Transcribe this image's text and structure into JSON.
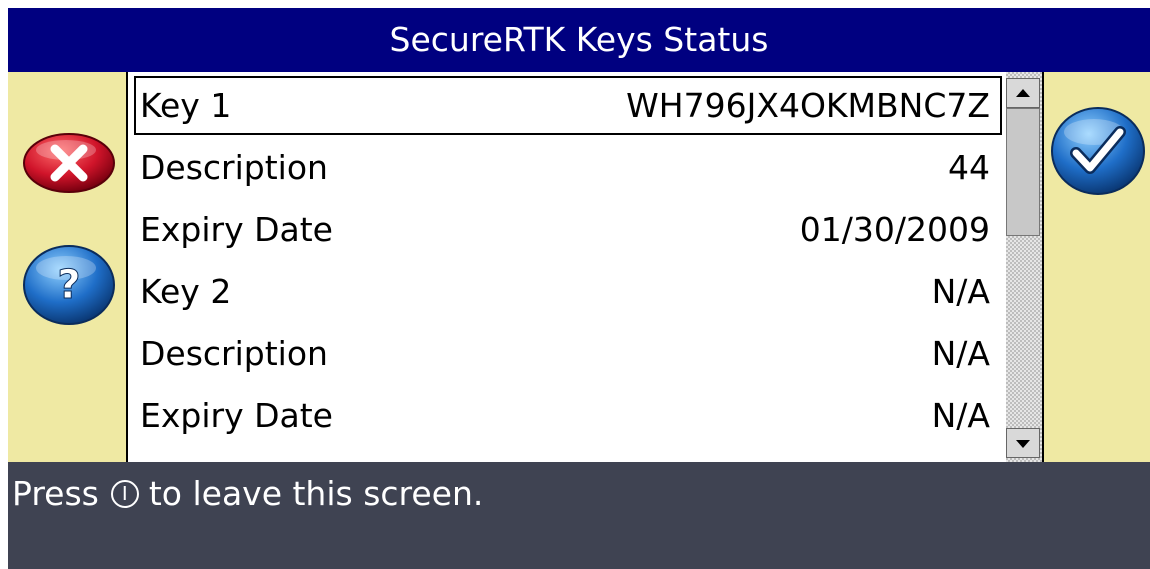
{
  "header": {
    "title": "SecureRTK Keys Status"
  },
  "list": {
    "rows": [
      {
        "label": "Key 1",
        "value": "WH796JX4OKMBNC7Z"
      },
      {
        "label": "Description",
        "value": "44"
      },
      {
        "label": "Expiry Date",
        "value": "01/30/2009"
      },
      {
        "label": "Key 2",
        "value": "N/A"
      },
      {
        "label": "Description",
        "value": "N/A"
      },
      {
        "label": "Expiry Date",
        "value": "N/A"
      }
    ]
  },
  "footer": {
    "prefix": "Press",
    "suffix": "to leave this screen."
  },
  "colors": {
    "title_bg": "#000080",
    "panel_bg": "#efe9a3",
    "footer_bg": "#3f4352",
    "cancel_red": "#d0142a",
    "help_blue": "#1f6ec8",
    "ok_blue": "#1f6ec8"
  },
  "icons": {
    "cancel": "x-icon",
    "help": "question-icon",
    "confirm": "checkmark-icon",
    "power": "power-icon"
  }
}
